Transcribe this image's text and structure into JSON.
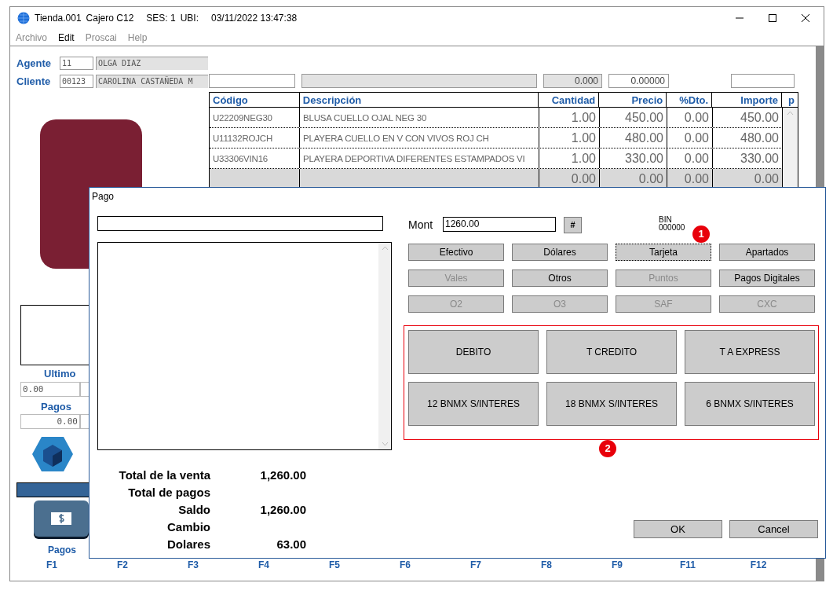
{
  "window": {
    "title_parts": [
      "Tienda.001",
      "Cajero C12",
      "SES: 1",
      "UBI:",
      "03/11/2022 13:47:38"
    ]
  },
  "menu": [
    {
      "label": "Archivo",
      "disabled": true
    },
    {
      "label": "Edit",
      "disabled": false
    },
    {
      "label": "Proscai",
      "disabled": true
    },
    {
      "label": "Help",
      "disabled": true
    }
  ],
  "agente": {
    "label": "Agente",
    "code": "11",
    "name": "OLGA DIAZ"
  },
  "cliente": {
    "label": "Cliente",
    "code": "00123",
    "name": "CAROLINA CASTAÑEDA M"
  },
  "header_fields": [
    {
      "kind": "editable"
    },
    {
      "kind": "readonly"
    },
    {
      "kind": "readonly",
      "value": "0.000"
    },
    {
      "kind": "editable",
      "value": "0.00000"
    },
    {
      "kind": "spacer"
    },
    {
      "kind": "editable"
    }
  ],
  "table": {
    "columns": [
      "Código",
      "Descripción",
      "Cantidad",
      "Precio",
      "%Dto.",
      "Importe",
      "p"
    ],
    "rows": [
      {
        "kind": "item",
        "cells": [
          "U22209NEG30",
          "BLUSA CUELLO OJAL NEG 30",
          "1.00",
          "450.00",
          "0.00",
          "450.00"
        ]
      },
      {
        "kind": "item",
        "cells": [
          "U11132ROJCH",
          "PLAYERA CUELLO EN V CON VIVOS ROJ CH",
          "1.00",
          "480.00",
          "0.00",
          "480.00"
        ]
      },
      {
        "kind": "item",
        "cells": [
          "U33306VIN16",
          "PLAYERA DEPORTIVA DIFERENTES ESTAMPADOS VI",
          "1.00",
          "330.00",
          "0.00",
          "330.00"
        ]
      },
      {
        "kind": "new",
        "cells": [
          "",
          "",
          "0.00",
          "0.00",
          "0.00",
          "0.00"
        ]
      }
    ]
  },
  "side": {
    "ultimo_label": "Ultimo",
    "ultimo_value": "0.00",
    "pagos_label": "Pagos",
    "pagos_value": "0.00"
  },
  "pagos_button": {
    "label": "Pagos"
  },
  "function_keys": [
    "F1",
    "F2",
    "F3",
    "F4",
    "F5",
    "F6",
    "F7",
    "F8",
    "F9",
    "F11",
    "F12"
  ],
  "dialog": {
    "title": "Pago",
    "mont_label": "Mont",
    "mont_value": "1260.00",
    "hash_button": "#",
    "bin_label": "BIN",
    "bin_value": "000000",
    "payment_buttons": [
      {
        "label": "Efectivo",
        "disabled": false,
        "focused": false
      },
      {
        "label": "Dólares",
        "disabled": false,
        "focused": false
      },
      {
        "label": "Tarjeta",
        "disabled": false,
        "focused": true
      },
      {
        "label": "Apartados",
        "disabled": false,
        "focused": false
      },
      {
        "label": "Vales",
        "disabled": true,
        "focused": false
      },
      {
        "label": "Otros",
        "disabled": false,
        "focused": false
      },
      {
        "label": "Puntos",
        "disabled": true,
        "focused": false
      },
      {
        "label": "Pagos Digitales",
        "disabled": false,
        "focused": false
      },
      {
        "label": "O2",
        "disabled": true,
        "focused": false
      },
      {
        "label": "O3",
        "disabled": true,
        "focused": false
      },
      {
        "label": "SAF",
        "disabled": true,
        "focused": false
      },
      {
        "label": "CXC",
        "disabled": true,
        "focused": false
      }
    ],
    "card_options": [
      "DEBITO",
      "T CREDITO",
      "T A EXPRESS",
      "12 BNMX S/INTERES",
      "18 BNMX S/INTERES",
      "6 BNMX S/INTERES"
    ],
    "totals": [
      {
        "label": "Total de la venta",
        "value": "1,260.00"
      },
      {
        "label": "Total de pagos"
      },
      {
        "label": "Saldo",
        "value": "1,260.00"
      },
      {
        "label": "Cambio"
      },
      {
        "label": "Dolares",
        "value": "63.00"
      }
    ],
    "buttons": [
      "OK",
      "Cancel"
    ]
  },
  "markers": [
    "1",
    "2"
  ]
}
